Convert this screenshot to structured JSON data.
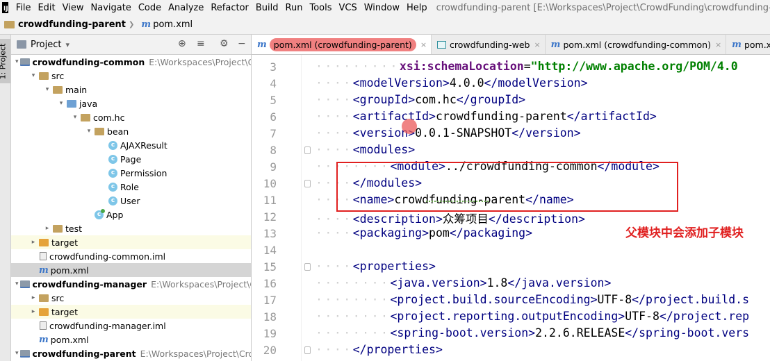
{
  "menubar": {
    "logo": "IJ",
    "items": [
      "File",
      "Edit",
      "View",
      "Navigate",
      "Code",
      "Analyze",
      "Refactor",
      "Build",
      "Run",
      "Tools",
      "VCS",
      "Window",
      "Help"
    ],
    "window_title": "crowdfunding-parent [E:\\Workspaces\\Project\\CrowdFunding\\crowdfunding-parent] -"
  },
  "navbar": {
    "project": "crowdfunding-parent",
    "separator": "❯",
    "file": "pom.xml"
  },
  "side_stripe": {
    "tab_label": "1: Project"
  },
  "project_panel": {
    "title": "Project",
    "dropdown": "▾",
    "tools": [
      "⊕",
      "≡",
      "⚙",
      "−"
    ],
    "tree": [
      {
        "depth": 0,
        "arrow": "▾",
        "icon": "module",
        "label": "crowdfunding-common",
        "bold": true,
        "path": "E:\\Workspaces\\Project\\Cro"
      },
      {
        "depth": 1,
        "arrow": "▾",
        "icon": "plain",
        "label": "src"
      },
      {
        "depth": 2,
        "arrow": "▾",
        "icon": "plain",
        "label": "main"
      },
      {
        "depth": 3,
        "arrow": "▾",
        "icon": "blue",
        "label": "java"
      },
      {
        "depth": 4,
        "arrow": "▾",
        "icon": "plain",
        "label": "com.hc"
      },
      {
        "depth": 5,
        "arrow": "▾",
        "icon": "plain",
        "label": "bean"
      },
      {
        "depth": 6,
        "arrow": "",
        "icon": "class",
        "label": "AJAXResult"
      },
      {
        "depth": 6,
        "arrow": "",
        "icon": "class",
        "label": "Page"
      },
      {
        "depth": 6,
        "arrow": "",
        "icon": "class",
        "label": "Permission"
      },
      {
        "depth": 6,
        "arrow": "",
        "icon": "class",
        "label": "Role"
      },
      {
        "depth": 6,
        "arrow": "",
        "icon": "class",
        "label": "User"
      },
      {
        "depth": 5,
        "arrow": "",
        "icon": "app",
        "label": "App"
      },
      {
        "depth": 2,
        "arrow": "▸",
        "icon": "plain",
        "label": "test"
      },
      {
        "depth": 1,
        "arrow": "▸",
        "icon": "orange",
        "label": "target",
        "yellow": true
      },
      {
        "depth": 1,
        "arrow": "",
        "icon": "file",
        "label": "crowdfunding-common.iml"
      },
      {
        "depth": 1,
        "arrow": "",
        "icon": "maven",
        "label": "pom.xml",
        "selected": true
      },
      {
        "depth": 0,
        "arrow": "▾",
        "icon": "module",
        "label": "crowdfunding-manager",
        "bold": true,
        "path": "E:\\Workspaces\\Project\\Cro"
      },
      {
        "depth": 1,
        "arrow": "▸",
        "icon": "plain",
        "label": "src"
      },
      {
        "depth": 1,
        "arrow": "▸",
        "icon": "orange",
        "label": "target",
        "yellow": true
      },
      {
        "depth": 1,
        "arrow": "",
        "icon": "file",
        "label": "crowdfunding-manager.iml"
      },
      {
        "depth": 1,
        "arrow": "",
        "icon": "maven",
        "label": "pom.xml"
      },
      {
        "depth": 0,
        "arrow": "▾",
        "icon": "module",
        "label": "crowdfunding-parent",
        "bold": true,
        "path": "E:\\Workspaces\\Project\\Crow"
      }
    ]
  },
  "editor": {
    "tabs": [
      {
        "label": "pom.xml (crowdfunding-parent)",
        "icon": "maven",
        "active": true
      },
      {
        "label": "crowdfunding-web",
        "icon": "web"
      },
      {
        "label": "pom.xml (crowdfunding-common)",
        "icon": "maven"
      },
      {
        "label": "pom.xml (crowdfunding-",
        "icon": "maven"
      }
    ],
    "close_glyph": "×",
    "lines": [
      {
        "n": "3",
        "indent": "·········",
        "parts": [
          [
            "an",
            "xsi:schemaLocation"
          ],
          [
            "tx",
            "="
          ],
          [
            "av",
            "\"http://www.apache.org/POM/4.0"
          ]
        ]
      },
      {
        "n": "4",
        "indent": "····",
        "parts": [
          [
            "tg",
            "<modelVersion>"
          ],
          [
            "tx",
            "4.0.0"
          ],
          [
            "tg",
            "</modelVersion>"
          ]
        ]
      },
      {
        "n": "5",
        "indent": "····",
        "parts": [
          [
            "tg",
            "<groupId>"
          ],
          [
            "tx",
            "com.hc"
          ],
          [
            "tg",
            "</groupId>"
          ]
        ]
      },
      {
        "n": "6",
        "indent": "····",
        "parts": [
          [
            "tg",
            "<artifactId>"
          ],
          [
            "tx",
            "crowdfunding-parent"
          ],
          [
            "tg",
            "</artifactId>"
          ]
        ]
      },
      {
        "n": "7",
        "indent": "····",
        "parts": [
          [
            "tg",
            "<version>"
          ],
          [
            "tx",
            "0.0.1-SNAPSHOT"
          ],
          [
            "tg",
            "</version>"
          ]
        ]
      },
      {
        "n": "8",
        "indent": "····",
        "parts": [
          [
            "tg",
            "<modules>"
          ]
        ],
        "fold": true
      },
      {
        "n": "9",
        "indent": "········",
        "parts": [
          [
            "tg",
            "<module>"
          ],
          [
            "tx",
            "../crowdfunding-common"
          ],
          [
            "tg",
            "</module>"
          ]
        ]
      },
      {
        "n": "10",
        "indent": "····",
        "parts": [
          [
            "tg",
            "</modules>"
          ]
        ],
        "fold": true
      },
      {
        "n": "11",
        "indent": "····",
        "parts": [
          [
            "tg",
            "<name>"
          ],
          [
            "tx",
            "crowdfunding-parent"
          ],
          [
            "tg",
            "</name>"
          ]
        ]
      },
      {
        "n": "12",
        "indent": "····",
        "parts": [
          [
            "tg",
            "<description>"
          ],
          [
            "cjk",
            "众筹项目"
          ],
          [
            "tg",
            "</description>"
          ]
        ]
      },
      {
        "n": "13",
        "indent": "····",
        "parts": [
          [
            "tg",
            "<packaging>"
          ],
          [
            "tx",
            "pom"
          ],
          [
            "tg",
            "</packaging>"
          ]
        ]
      },
      {
        "n": "14",
        "indent": "",
        "parts": []
      },
      {
        "n": "15",
        "indent": "····",
        "parts": [
          [
            "tg",
            "<properties>"
          ]
        ],
        "fold": true
      },
      {
        "n": "16",
        "indent": "········",
        "parts": [
          [
            "tg",
            "<java.version>"
          ],
          [
            "tx",
            "1.8"
          ],
          [
            "tg",
            "</java.version>"
          ]
        ]
      },
      {
        "n": "17",
        "indent": "········",
        "parts": [
          [
            "tg",
            "<project.build.sourceEncoding>"
          ],
          [
            "tx",
            "UTF-8"
          ],
          [
            "tg",
            "</project.build.s"
          ]
        ]
      },
      {
        "n": "18",
        "indent": "········",
        "parts": [
          [
            "tg",
            "<project.reporting.outputEncoding>"
          ],
          [
            "tx",
            "UTF-8"
          ],
          [
            "tg",
            "</project.rep"
          ]
        ]
      },
      {
        "n": "19",
        "indent": "········",
        "parts": [
          [
            "tg",
            "<spring-boot.version>"
          ],
          [
            "tx",
            "2.2.6.RELEASE"
          ],
          [
            "tg",
            "</spring-boot.vers"
          ]
        ]
      },
      {
        "n": "20",
        "indent": "····",
        "parts": [
          [
            "tg",
            "</properties>"
          ]
        ],
        "fold": true
      }
    ],
    "annotation": "父模块中会添加子模块"
  }
}
